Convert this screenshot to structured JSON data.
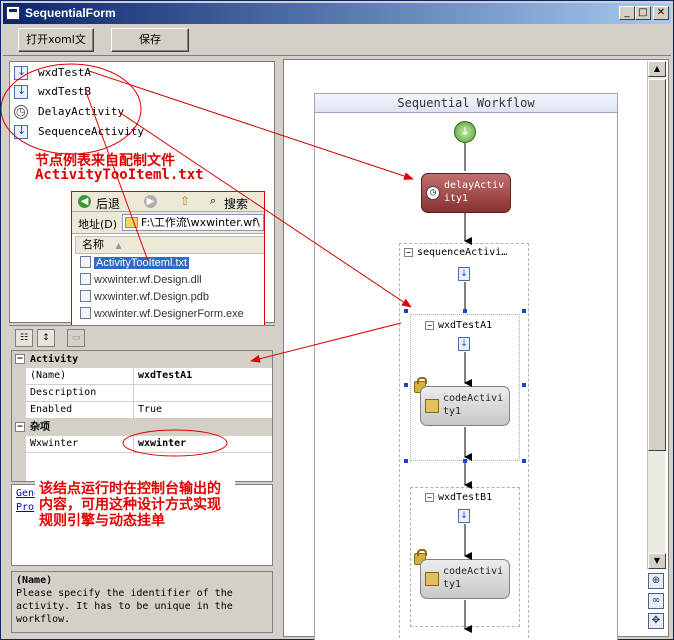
{
  "window": {
    "title": "SequentialForm",
    "minimize_glyph": "_",
    "maximize_glyph": "□",
    "close_glyph": "✕"
  },
  "toolbar": {
    "open_label": "打开xoml文",
    "save_label": "保存"
  },
  "activity_list": {
    "items": [
      {
        "label": "wxdTestA",
        "icon": "activity-icon"
      },
      {
        "label": "wxdTestB",
        "icon": "activity-icon"
      },
      {
        "label": "DelayActivity",
        "icon": "clock-icon"
      },
      {
        "label": "SequenceActivity",
        "icon": "activity-icon"
      }
    ]
  },
  "annotations": {
    "list_note_line1": "节点例表来自配制文件",
    "list_note_line2": "ActivityTooIteml.txt",
    "output_note": "该结点运行时在控制台输出的内容，可用这种设计方式实现规则引擎与动态挂单"
  },
  "explorer": {
    "back_label": "后退",
    "search_label": "搜索",
    "address_label": "地址(D)",
    "address_value": "F:\\工作流\\wxwinter.wf\\",
    "column_name": "名称",
    "files": [
      {
        "name": "ActivityTooIteml.txt",
        "selected": true
      },
      {
        "name": "wxwinter.wf.Design.dll",
        "selected": false
      },
      {
        "name": "wxwinter.wf.Design.pdb",
        "selected": false
      },
      {
        "name": "wxwinter.wf.DesignerForm.exe",
        "selected": false
      }
    ]
  },
  "property_grid": {
    "categories": [
      {
        "label": "Activity",
        "toggle": "−"
      },
      {
        "label": "杂项",
        "toggle": "−"
      }
    ],
    "rows": [
      {
        "key": "(Name)",
        "value": "wxdTestA1"
      },
      {
        "key": "Description",
        "value": ""
      },
      {
        "key": "Enabled",
        "value": "True"
      },
      {
        "key": "Wxwinter",
        "value": "wxwinter"
      }
    ],
    "commands": [
      "Gene",
      "Prop"
    ],
    "help_title": "(Name)",
    "help_text": "Please specify the identifier of the activity. It has to be unique in the workflow."
  },
  "designer": {
    "header": "Sequential Workflow",
    "delay_activity": "delayActivity1",
    "sequence_activity": "sequenceActivi…",
    "groups": [
      {
        "title": "wxdTestA1",
        "child": "codeActivity1"
      },
      {
        "title": "wxdTestB1",
        "child": "codeActivity1"
      }
    ]
  },
  "colors": {
    "annotation": "#e00000",
    "titlebar_start": "#0a246a",
    "titlebar_end": "#a6caf0",
    "delay_activity": "#8a3030"
  }
}
